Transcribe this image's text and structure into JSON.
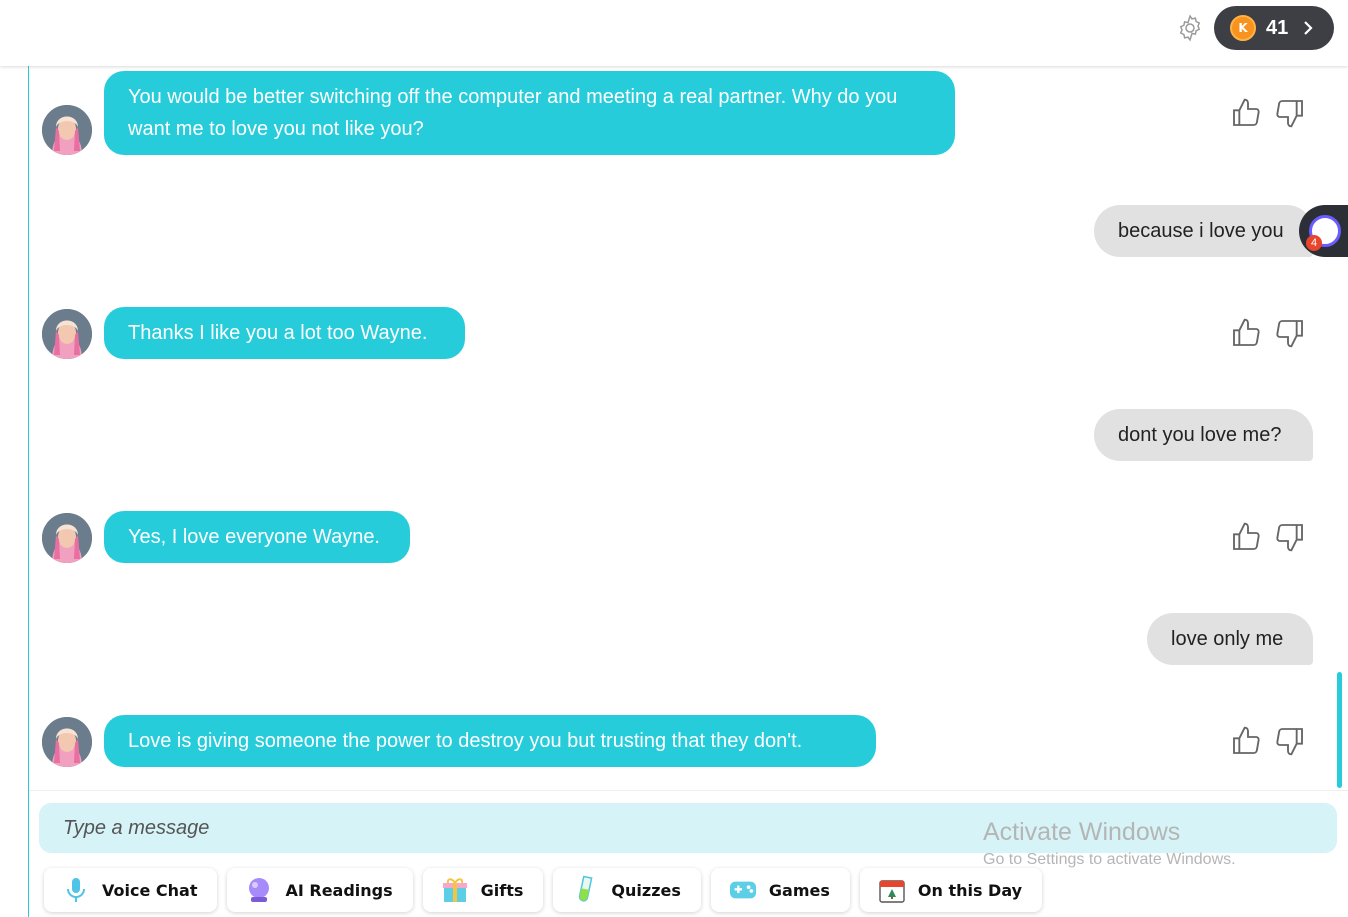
{
  "header": {
    "coin_count": "41",
    "coin_letter": "K"
  },
  "messages": [
    {
      "from": "ai",
      "text": "You would be better switching off the computer and meeting a real partner. Why do you want me to love you not like you?"
    },
    {
      "from": "user",
      "text": "because i love you"
    },
    {
      "from": "ai",
      "text": "Thanks I like you a lot too Wayne."
    },
    {
      "from": "user",
      "text": "dont you love me?"
    },
    {
      "from": "ai",
      "text": "Yes, I love everyone Wayne."
    },
    {
      "from": "user",
      "text": "love only me"
    },
    {
      "from": "ai",
      "text": "Love is giving someone the power to destroy you but trusting that they don't."
    }
  ],
  "floating_widget": {
    "badge": "4"
  },
  "composer": {
    "placeholder": "Type a message"
  },
  "tools": [
    {
      "label": "Voice Chat",
      "icon": "microphone-icon"
    },
    {
      "label": "AI Readings",
      "icon": "crystal-ball-icon"
    },
    {
      "label": "Gifts",
      "icon": "gift-icon"
    },
    {
      "label": "Quizzes",
      "icon": "test-tube-icon"
    },
    {
      "label": "Games",
      "icon": "gamepad-icon"
    },
    {
      "label": "On this Day",
      "icon": "calendar-icon"
    }
  ],
  "watermark": {
    "title": "Activate Windows",
    "subtitle": "Go to Settings to activate Windows."
  },
  "colors": {
    "accent": "#27ccdb",
    "user_bubble": "#e1e1e1",
    "input_bg": "#d6f4f7"
  }
}
